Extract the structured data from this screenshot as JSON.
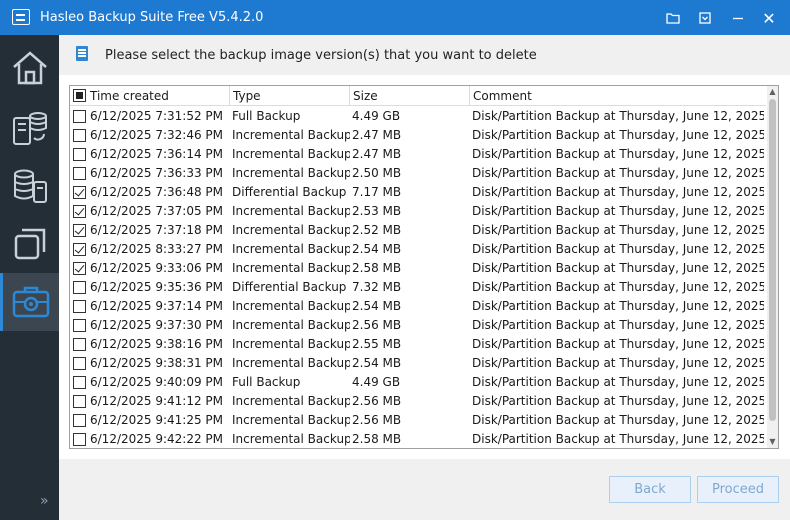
{
  "window": {
    "title": "Hasleo Backup Suite Free V5.4.2.0"
  },
  "titlebar_buttons": {
    "close": "✕"
  },
  "sidebar": {
    "expand": "»"
  },
  "instruction": "Please select the backup image version(s) that you want to delete",
  "table": {
    "columns": {
      "time": "Time created",
      "type": "Type",
      "size": "Size",
      "comment": "Comment"
    },
    "rows": [
      {
        "checked": false,
        "time": "6/12/2025 7:31:52 PM",
        "type": "Full Backup",
        "size": "4.49 GB",
        "comment": "Disk/Partition Backup at Thursday, June 12, 2025..."
      },
      {
        "checked": false,
        "time": "6/12/2025 7:32:46 PM",
        "type": "Incremental Backup",
        "size": "2.47 MB",
        "comment": "Disk/Partition Backup at Thursday, June 12, 2025..."
      },
      {
        "checked": false,
        "time": "6/12/2025 7:36:14 PM",
        "type": "Incremental Backup",
        "size": "2.47 MB",
        "comment": "Disk/Partition Backup at Thursday, June 12, 2025..."
      },
      {
        "checked": false,
        "time": "6/12/2025 7:36:33 PM",
        "type": "Incremental Backup",
        "size": "2.50 MB",
        "comment": "Disk/Partition Backup at Thursday, June 12, 2025..."
      },
      {
        "checked": true,
        "time": "6/12/2025 7:36:48 PM",
        "type": "Differential Backup",
        "size": "7.17 MB",
        "comment": "Disk/Partition Backup at Thursday, June 12, 2025..."
      },
      {
        "checked": true,
        "time": "6/12/2025 7:37:05 PM",
        "type": "Incremental Backup",
        "size": "2.53 MB",
        "comment": "Disk/Partition Backup at Thursday, June 12, 2025..."
      },
      {
        "checked": true,
        "time": "6/12/2025 7:37:18 PM",
        "type": "Incremental Backup",
        "size": "2.52 MB",
        "comment": "Disk/Partition Backup at Thursday, June 12, 2025..."
      },
      {
        "checked": true,
        "time": "6/12/2025 8:33:27 PM",
        "type": "Incremental Backup",
        "size": "2.54 MB",
        "comment": "Disk/Partition Backup at Thursday, June 12, 2025..."
      },
      {
        "checked": true,
        "time": "6/12/2025 9:33:06 PM",
        "type": "Incremental Backup",
        "size": "2.58 MB",
        "comment": "Disk/Partition Backup at Thursday, June 12, 2025..."
      },
      {
        "checked": false,
        "time": "6/12/2025 9:35:36 PM",
        "type": "Differential Backup",
        "size": "7.32 MB",
        "comment": "Disk/Partition Backup at Thursday, June 12, 2025..."
      },
      {
        "checked": false,
        "time": "6/12/2025 9:37:14 PM",
        "type": "Incremental Backup",
        "size": "2.54 MB",
        "comment": "Disk/Partition Backup at Thursday, June 12, 2025..."
      },
      {
        "checked": false,
        "time": "6/12/2025 9:37:30 PM",
        "type": "Incremental Backup",
        "size": "2.56 MB",
        "comment": "Disk/Partition Backup at Thursday, June 12, 2025..."
      },
      {
        "checked": false,
        "time": "6/12/2025 9:38:16 PM",
        "type": "Incremental Backup",
        "size": "2.55 MB",
        "comment": "Disk/Partition Backup at Thursday, June 12, 2025..."
      },
      {
        "checked": false,
        "time": "6/12/2025 9:38:31 PM",
        "type": "Incremental Backup",
        "size": "2.54 MB",
        "comment": "Disk/Partition Backup at Thursday, June 12, 2025..."
      },
      {
        "checked": false,
        "time": "6/12/2025 9:40:09 PM",
        "type": "Full Backup",
        "size": "4.49 GB",
        "comment": "Disk/Partition Backup at Thursday, June 12, 2025..."
      },
      {
        "checked": false,
        "time": "6/12/2025 9:41:12 PM",
        "type": "Incremental Backup",
        "size": "2.56 MB",
        "comment": "Disk/Partition Backup at Thursday, June 12, 2025..."
      },
      {
        "checked": false,
        "time": "6/12/2025 9:41:25 PM",
        "type": "Incremental Backup",
        "size": "2.56 MB",
        "comment": "Disk/Partition Backup at Thursday, June 12, 2025..."
      },
      {
        "checked": false,
        "time": "6/12/2025 9:42:22 PM",
        "type": "Incremental Backup",
        "size": "2.58 MB",
        "comment": "Disk/Partition Backup at Thursday, June 12, 2025..."
      }
    ]
  },
  "buttons": {
    "back": "Back",
    "proceed": "Proceed"
  },
  "colors": {
    "titlebar": "#1e7ad0",
    "sidebar": "#242e37",
    "accent": "#2d89d6"
  }
}
